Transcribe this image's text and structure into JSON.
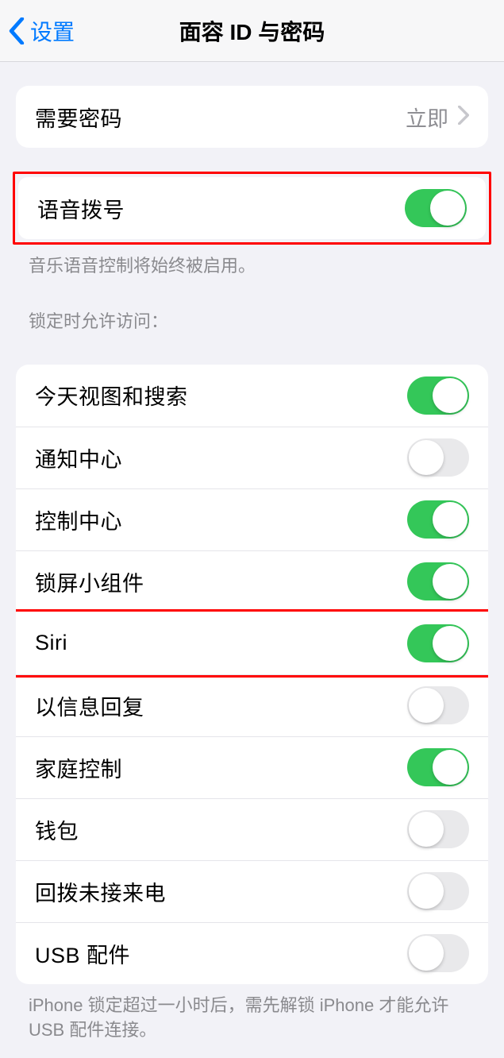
{
  "header": {
    "back_label": "设置",
    "title": "面容 ID 与密码"
  },
  "require_passcode": {
    "label": "需要密码",
    "value": "立即"
  },
  "voice_dial": {
    "label": "语音拨号",
    "on": true,
    "footer": "音乐语音控制将始终被启用。"
  },
  "locked_access": {
    "header": "锁定时允许访问：",
    "items": [
      {
        "label": "今天视图和搜索",
        "on": true
      },
      {
        "label": "通知中心",
        "on": false
      },
      {
        "label": "控制中心",
        "on": true
      },
      {
        "label": "锁屏小组件",
        "on": true
      },
      {
        "label": "Siri",
        "on": true
      },
      {
        "label": "以信息回复",
        "on": false
      },
      {
        "label": "家庭控制",
        "on": true
      },
      {
        "label": "钱包",
        "on": false
      },
      {
        "label": "回拨未接来电",
        "on": false
      },
      {
        "label": "USB 配件",
        "on": false
      }
    ],
    "footer": "iPhone 锁定超过一小时后，需先解锁 iPhone 才能允许 USB 配件连接。"
  }
}
